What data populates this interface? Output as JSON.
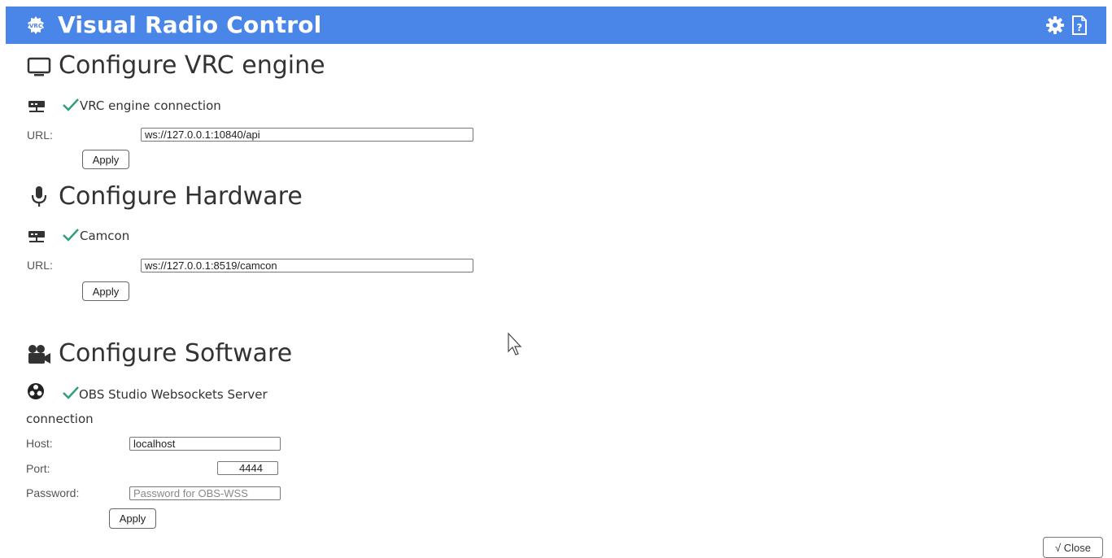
{
  "app": {
    "title": "Visual Radio Control",
    "accent": "#4a86e8",
    "logo_text": "VRC"
  },
  "toolbar": {
    "settings_icon": "gear-icon",
    "help_icon": "help-file-icon"
  },
  "sections": {
    "engine": {
      "heading": "Configure VRC engine",
      "icon": "monitor-icon",
      "connection_label": "VRC engine connection",
      "url_label": "URL:",
      "url_value": "ws://127.0.0.1:10840/api",
      "apply_label": "Apply"
    },
    "hardware": {
      "heading": "Configure Hardware",
      "icon": "microphone-icon",
      "connection_label": "Camcon",
      "url_label": "URL:",
      "url_value": "ws://127.0.0.1:8519/camcon",
      "apply_label": "Apply"
    },
    "software": {
      "heading": "Configure Software",
      "icon": "video-camera-icon",
      "connection_label": "OBS Studio Websockets Server",
      "connection_label_cont": "connection",
      "host_label": "Host:",
      "host_value": "localhost",
      "port_label": "Port:",
      "port_value": "4444",
      "password_label": "Password:",
      "password_placeholder": "Password for OBS-WSS",
      "apply_label": "Apply"
    }
  },
  "footer": {
    "close_label": "√ Close"
  },
  "status_color": "#2e9e7e"
}
